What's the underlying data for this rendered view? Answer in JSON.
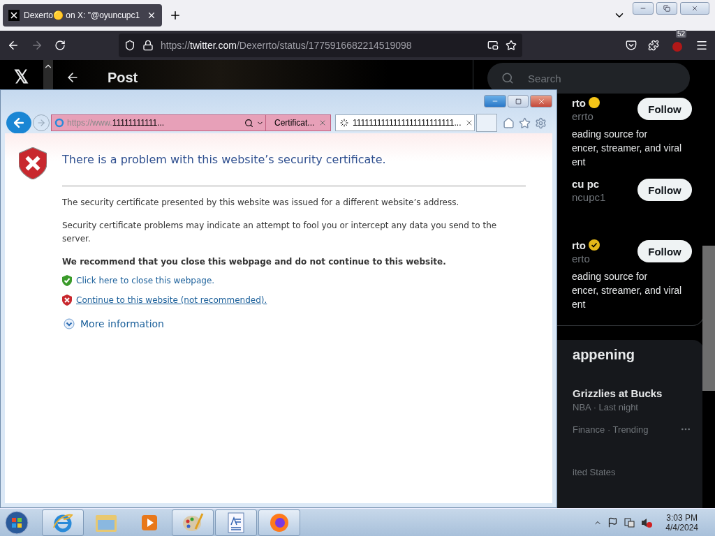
{
  "firefox": {
    "tab": {
      "title": "Dexerto🟡 on X: \"@oyuncupc1"
    },
    "url": {
      "host": "twitter.com",
      "before": "https://",
      "after": "/Dexerrto/status/1775916682214519098"
    },
    "extension_badge": "52"
  },
  "twitter": {
    "logo": "𝕏",
    "header": {
      "title": "Post"
    },
    "search": {
      "placeholder": "Search"
    },
    "follow": [
      {
        "name": "rto",
        "kind": "round",
        "handle": "errto",
        "bio": "eading source for\nencer, streamer, and viral\nent",
        "button": "Follow"
      },
      {
        "name": "cu pc",
        "kind": "plain",
        "handle": "ncupc1",
        "button": "Follow"
      },
      {
        "name": "rto",
        "kind": "verified",
        "handle": "erto",
        "bio": "eading source for\nencer, streamer, and viral\nent",
        "button": "Follow"
      }
    ],
    "happening": {
      "title": "appening",
      "items": [
        {
          "headline": "Grizzlies at Bucks",
          "sub": "NBA · Last night"
        },
        {
          "meta": "Finance · Trending"
        },
        {
          "meta": "ited States"
        }
      ]
    }
  },
  "ie": {
    "address": {
      "prefix": "https://www.",
      "rest": "11111111111..."
    },
    "tabs": [
      {
        "title": "Certificat...",
        "kind": "error",
        "selected": true
      },
      {
        "title": "1111111111111111111111111...",
        "kind": "loading",
        "selected": false
      }
    ],
    "heading": "There is a problem with this website’s security certificate.",
    "paragraphs": [
      "The security certificate presented by this website was issued for a different website’s address.",
      "Security certificate problems may indicate an attempt to fool you or intercept any data you send to the server."
    ],
    "recommendation": "We recommend that you close this webpage and do not continue to this website.",
    "links": [
      {
        "text": "Click here to close this webpage.",
        "kind": "safe"
      },
      {
        "text": "Continue to this website (not recommended).",
        "kind": "danger"
      }
    ],
    "more": "More information"
  },
  "taskbar": {
    "apps": [
      {
        "kind": "ie",
        "running": true
      },
      {
        "kind": "explorer",
        "running": false
      },
      {
        "kind": "media",
        "running": false
      },
      {
        "kind": "paint",
        "running": true
      },
      {
        "kind": "wordpad",
        "running": true
      },
      {
        "kind": "firefox",
        "running": true
      }
    ],
    "time": "3:03 PM",
    "date": "4/4/2024"
  }
}
